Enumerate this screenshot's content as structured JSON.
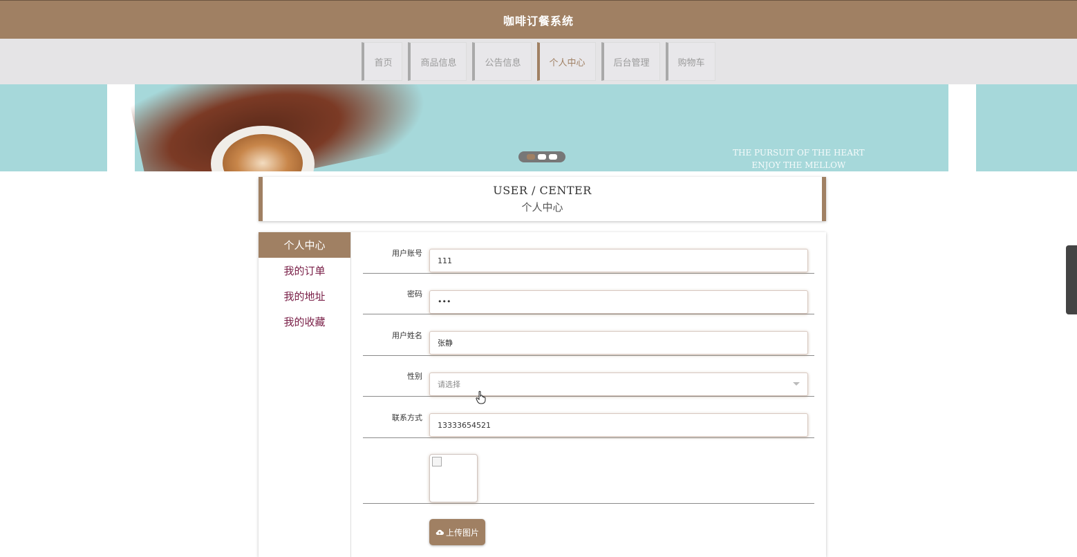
{
  "header": {
    "title": "咖啡订餐系统"
  },
  "nav": {
    "items": [
      {
        "label": "首页"
      },
      {
        "label": "商品信息"
      },
      {
        "label": "公告信息"
      },
      {
        "label": "个人中心"
      },
      {
        "label": "后台管理"
      },
      {
        "label": "购物车"
      }
    ],
    "active_index": 3,
    "accent_color": "#a08063"
  },
  "banner": {
    "text_line1": "THE PURSUIT OF THE HEART",
    "text_line2": "ENJOY THE MELLOW",
    "slides": 3,
    "active_slide": 0
  },
  "section": {
    "title_en": "USER / CENTER",
    "title_zh": "个人中心"
  },
  "sidebar": {
    "items": [
      {
        "label": "个人中心"
      },
      {
        "label": "我的订单"
      },
      {
        "label": "我的地址"
      },
      {
        "label": "我的收藏"
      }
    ],
    "active_index": 0
  },
  "form": {
    "fields": [
      {
        "label": "用户账号",
        "value": "111"
      },
      {
        "label": "密码",
        "value": "•••"
      },
      {
        "label": "用户姓名",
        "value": "张静"
      },
      {
        "label": "性别",
        "value": "请选择"
      },
      {
        "label": "联系方式",
        "value": "13333654521"
      }
    ],
    "upload_label": "上传图片"
  },
  "icons": {
    "upload": "cloud-upload-icon",
    "caret": "chevron-down-icon",
    "cursor": "hand-pointer-icon"
  }
}
